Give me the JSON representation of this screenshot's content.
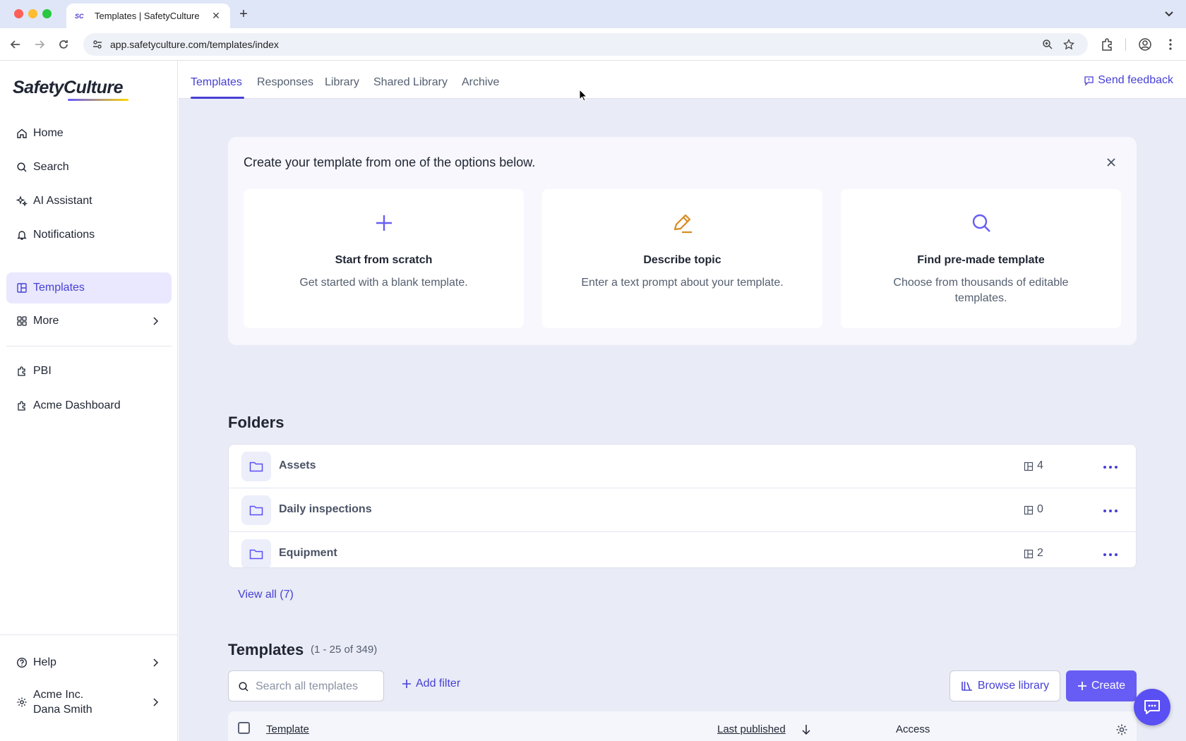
{
  "browser": {
    "tab_title": "Templates | SafetyCulture",
    "favicon_text": "SC",
    "url": "app.safetyculture.com/templates/index"
  },
  "sidebar": {
    "logo": "SafetyCulture",
    "items": [
      {
        "label": "Home",
        "icon": "home-icon"
      },
      {
        "label": "Search",
        "icon": "search-icon"
      },
      {
        "label": "AI Assistant",
        "icon": "sparkle-icon"
      },
      {
        "label": "Notifications",
        "icon": "bell-icon"
      },
      {
        "label": "Templates",
        "icon": "template-icon",
        "active": true
      },
      {
        "label": "More",
        "icon": "grid-icon"
      }
    ],
    "integrations": [
      {
        "label": "PBI",
        "icon": "puzzle-icon"
      },
      {
        "label": "Acme Dashboard",
        "icon": "puzzle-icon"
      }
    ],
    "help": "Help",
    "org": {
      "name": "Acme Inc.",
      "user": "Dana Smith"
    }
  },
  "topnav": {
    "tabs": [
      "Templates",
      "Responses",
      "Library",
      "Shared Library",
      "Archive"
    ],
    "active": "Templates",
    "feedback": "Send feedback"
  },
  "create_panel": {
    "title": "Create your template from one of the options below.",
    "options": [
      {
        "title": "Start from scratch",
        "desc": "Get started with a blank template.",
        "icon": "plus-icon"
      },
      {
        "title": "Describe topic",
        "desc": "Enter a text prompt about your template.",
        "icon": "pencil-icon"
      },
      {
        "title": "Find pre-made template",
        "desc": "Choose from thousands of editable templates.",
        "icon": "magnifier-icon"
      }
    ]
  },
  "folders": {
    "title": "Folders",
    "items": [
      {
        "name": "Assets",
        "count": "4"
      },
      {
        "name": "Daily inspections",
        "count": "0"
      },
      {
        "name": "Equipment",
        "count": "2"
      }
    ],
    "view_all": "View all (7)"
  },
  "templates": {
    "title": "Templates",
    "count": "(1 - 25 of 349)",
    "search_placeholder": "Search all templates",
    "add_filter": "Add filter",
    "browse_library": "Browse library",
    "create": "Create",
    "columns": {
      "template": "Template",
      "last_published": "Last published",
      "access": "Access"
    }
  },
  "colors": {
    "accent": "#4740d4",
    "primary_button": "#675df4",
    "active_nav_bg": "#e9e8ff",
    "page_bg": "#e9ebf6"
  }
}
